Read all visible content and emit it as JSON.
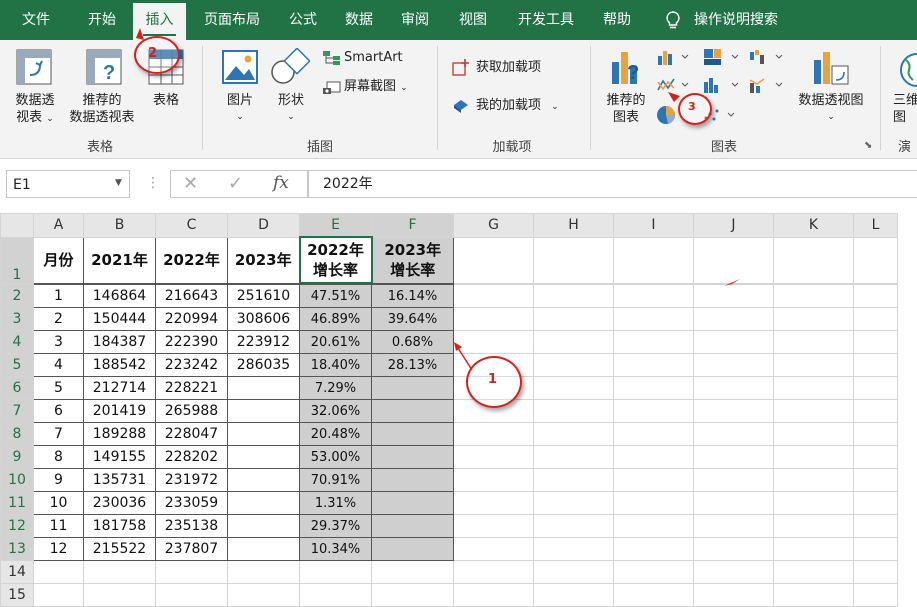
{
  "menu": {
    "tabs": [
      "文件",
      "开始",
      "插入",
      "页面布局",
      "公式",
      "数据",
      "审阅",
      "视图",
      "开发工具",
      "帮助"
    ],
    "active": "插入",
    "search_label": "操作说明搜索"
  },
  "ribbon": {
    "tables_group": {
      "label": "表格",
      "pivot_line1": "数据透",
      "pivot_line2": "视表",
      "recommended_pivot_line1": "推荐的",
      "recommended_pivot_line2": "数据透视表",
      "table": "表格"
    },
    "illustrations_group": {
      "label": "插图",
      "pictures": "图片",
      "shapes": "形状",
      "smartart": "SmartArt",
      "screenshot": "屏幕截图"
    },
    "addins_group": {
      "label": "加载项",
      "get_addins": "获取加载项",
      "my_addins": "我的加载项"
    },
    "charts_group": {
      "label": "图表",
      "recommended_line1": "推荐的",
      "recommended_line2": "图表",
      "pivotchart": "数据透视图"
    },
    "tours_group": {
      "label_partial": "演",
      "btn_partial_line1": "三维",
      "btn_partial_line2": "图"
    }
  },
  "formula_bar": {
    "name_box": "E1",
    "formula": "2022年"
  },
  "sheet": {
    "columns": [
      "A",
      "B",
      "C",
      "D",
      "E",
      "F",
      "G",
      "H",
      "I",
      "J",
      "K",
      "L"
    ],
    "header_row": [
      "月份",
      "2021年",
      "2022年",
      "2023年",
      "2022年增长率",
      "2023年增长率"
    ],
    "rows": [
      [
        "1",
        "146864",
        "216643",
        "251610",
        "47.51%",
        "16.14%"
      ],
      [
        "2",
        "150444",
        "220994",
        "308606",
        "46.89%",
        "39.64%"
      ],
      [
        "3",
        "184387",
        "222390",
        "223912",
        "20.61%",
        "0.68%"
      ],
      [
        "4",
        "188542",
        "223242",
        "286035",
        "18.40%",
        "28.13%"
      ],
      [
        "5",
        "212714",
        "228221",
        "",
        "7.29%",
        ""
      ],
      [
        "6",
        "201419",
        "265988",
        "",
        "32.06%",
        ""
      ],
      [
        "7",
        "189288",
        "228047",
        "",
        "20.48%",
        ""
      ],
      [
        "8",
        "149155",
        "228202",
        "",
        "53.00%",
        ""
      ],
      [
        "9",
        "135731",
        "231972",
        "",
        "70.91%",
        ""
      ],
      [
        "10",
        "230036",
        "233059",
        "",
        "1.31%",
        ""
      ],
      [
        "11",
        "181758",
        "235138",
        "",
        "29.37%",
        ""
      ],
      [
        "12",
        "215522",
        "237807",
        "",
        "10.34%",
        ""
      ]
    ],
    "row_numbers": [
      "1",
      "2",
      "3",
      "4",
      "5",
      "6",
      "7",
      "8",
      "9",
      "10",
      "11",
      "12",
      "13",
      "14",
      "15"
    ]
  },
  "annotations": {
    "step1": "1",
    "step2": "2",
    "step3": "3",
    "accent_color": "#d3221c"
  },
  "colors": {
    "brand": "#217346",
    "selection": "#cfcfcf"
  }
}
